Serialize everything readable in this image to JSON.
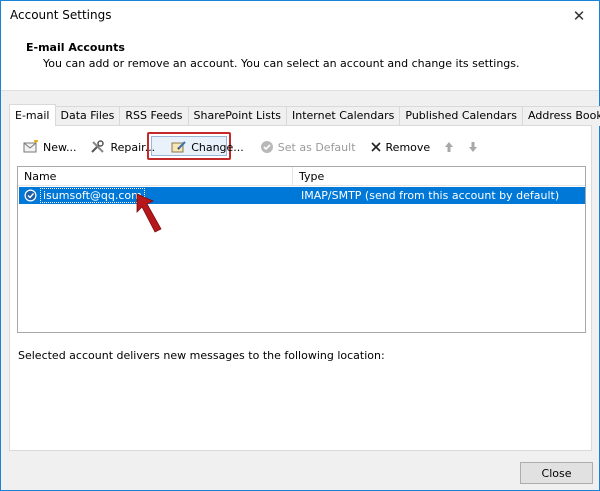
{
  "window": {
    "title": "Account Settings"
  },
  "header": {
    "title": "E-mail Accounts",
    "description": "You can add or remove an account. You can select an account and change its settings."
  },
  "tabs": [
    {
      "label": "E-mail",
      "active": true
    },
    {
      "label": "Data Files"
    },
    {
      "label": "RSS Feeds"
    },
    {
      "label": "SharePoint Lists"
    },
    {
      "label": "Internet Calendars"
    },
    {
      "label": "Published Calendars"
    },
    {
      "label": "Address Books"
    }
  ],
  "toolbar": {
    "new_label": "New...",
    "repair_label": "Repair...",
    "change_label": "Change...",
    "set_default_label": "Set as Default",
    "remove_label": "Remove"
  },
  "list": {
    "columns": [
      "Name",
      "Type"
    ],
    "rows": [
      {
        "name": "isumsoft@qq.com",
        "type": "IMAP/SMTP (send from this account by default)"
      }
    ]
  },
  "footer": {
    "delivery_text": "Selected account delivers new messages to the following location:",
    "close_label": "Close"
  },
  "colors": {
    "selection": "#0078d7",
    "highlight_box": "#c42a2a",
    "arrow": "#b5171b"
  }
}
